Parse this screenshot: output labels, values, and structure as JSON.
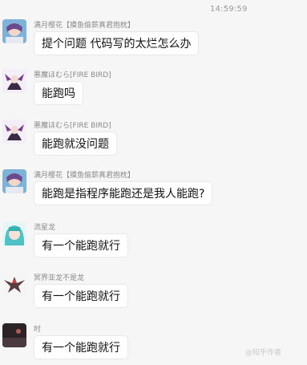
{
  "timestamp": "14:59:59",
  "messages": [
    {
      "sender": "满月樱花【摸鱼偷薪真君抱枕】",
      "text": "提个问题 代码写的太烂怎么办",
      "avatar_icon": "anime-avatar-icon"
    },
    {
      "sender": "悪魔ほむら[FIRE BIRD]",
      "text": "能跑吗",
      "avatar_icon": "demon-avatar-icon"
    },
    {
      "sender": "悪魔ほむら[FIRE BIRD]",
      "text": "能跑就没问题",
      "avatar_icon": "demon-avatar-icon"
    },
    {
      "sender": "满月樱花【摸鱼偷薪真君抱枕】",
      "text": "能跑是指程序能跑还是我人能跑?",
      "avatar_icon": "anime-avatar-icon"
    },
    {
      "sender": "流星龙",
      "text": "有一个能跑就行",
      "avatar_icon": "miku-avatar-icon"
    },
    {
      "sender": "冥界亚龙不是龙",
      "text": "有一个能跑就行",
      "avatar_icon": "wyvern-avatar-icon"
    },
    {
      "sender": "时",
      "text": "有一个能跑就行",
      "avatar_icon": "dark-avatar-icon"
    }
  ],
  "watermark": "@知乎作者"
}
